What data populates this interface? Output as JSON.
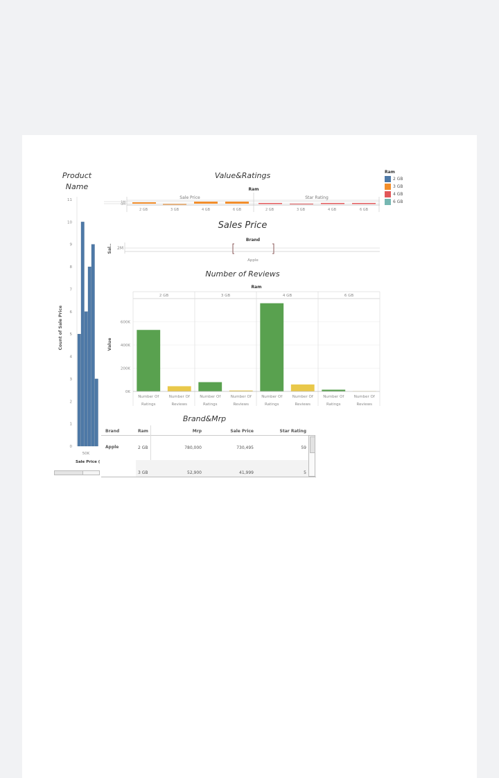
{
  "titles": {
    "product_name": "Product\nName",
    "value_ratings": "Value&Ratings",
    "sales_price": "Sales Price",
    "number_of_reviews": "Number of Reviews",
    "brand_mrp": "Brand&Mrp"
  },
  "legend": {
    "title": "Ram",
    "items": [
      {
        "label": "2 GB",
        "color": "#4e79a7"
      },
      {
        "label": "3 GB",
        "color": "#f28e2b"
      },
      {
        "label": "4 GB",
        "color": "#e15759"
      },
      {
        "label": "6 GB",
        "color": "#76b7b2"
      }
    ]
  },
  "value_ratings": {
    "ram_label": "Ram",
    "sale_price_label": "Sale Price",
    "star_rating_label": "Star Rating",
    "y_tick_1": "1M",
    "y_tick_2": "0M",
    "ram_ticks": [
      "2 GB",
      "3 GB",
      "4 GB",
      "6 GB",
      "2 GB",
      "3 GB",
      "4 GB",
      "6 GB"
    ]
  },
  "sales_price": {
    "brand_label": "Brand",
    "y_label": "Sal..",
    "y_tick": "2M",
    "x_tick": "Apple"
  },
  "table": {
    "headers": [
      "Brand",
      "Ram",
      "Mrp",
      "Sale Price",
      "Star Rating"
    ],
    "rows": [
      {
        "brand": "Apple",
        "ram": "2 GB",
        "mrp": "780,000",
        "sale": "730,495",
        "star": "59"
      },
      {
        "brand": "",
        "ram": "3 GB",
        "mrp": "52,900",
        "sale": "41,999",
        "star": "5"
      }
    ]
  },
  "chart_data": [
    {
      "type": "bar",
      "title": "Product Name",
      "ylabel": "Count of Sale Price",
      "xlabel": "Sale Price (",
      "x_tick": "50K",
      "yticks": [
        0,
        1,
        2,
        3,
        4,
        5,
        6,
        7,
        8,
        9,
        10,
        11
      ],
      "ylim": [
        0,
        11
      ],
      "values": [
        5,
        10,
        6,
        8,
        9,
        3
      ],
      "color": "#4e79a7"
    },
    {
      "type": "bar",
      "title": "Number of Reviews",
      "ylabel": "Value",
      "facet_label": "Ram",
      "facets": [
        "2 GB",
        "3 GB",
        "4 GB",
        "6 GB"
      ],
      "category_line1": "Number Of",
      "categories": [
        "Ratings",
        "Reviews"
      ],
      "yticks": [
        "0K",
        "200K",
        "400K",
        "600K"
      ],
      "ylim": [
        0,
        800000
      ],
      "series": [
        {
          "values": [
            530000,
            80000,
            760000,
            15000
          ],
          "color": "#59a14f"
        },
        {
          "values": [
            45000,
            8000,
            60000,
            3000
          ],
          "color": "#e9c84a"
        }
      ]
    }
  ]
}
